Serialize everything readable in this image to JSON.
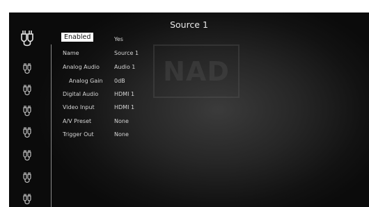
{
  "screen": {
    "title": "Source 1",
    "logo_text": "NAD"
  },
  "sidebar": {
    "icons": [
      {
        "name": "rca-connector-icon",
        "selected": true
      },
      {
        "name": "rca-connector-icon",
        "selected": false
      },
      {
        "name": "rca-connector-icon",
        "selected": false
      },
      {
        "name": "rca-connector-icon",
        "selected": false
      },
      {
        "name": "rca-connector-icon",
        "selected": false
      },
      {
        "name": "rca-connector-icon",
        "selected": false
      },
      {
        "name": "rca-connector-icon",
        "selected": false
      },
      {
        "name": "rca-connector-icon",
        "selected": false
      }
    ]
  },
  "settings": [
    {
      "label": "Enabled",
      "value": "Yes"
    },
    {
      "label": "Name",
      "value": "Source 1"
    },
    {
      "label": "Analog Audio",
      "value": "Audio 1"
    },
    {
      "label": "Analog Gain",
      "value": "0dB"
    },
    {
      "label": "Digital Audio",
      "value": "HDMI 1"
    },
    {
      "label": "Video Input",
      "value": "HDMI 1"
    },
    {
      "label": "A/V Preset",
      "value": "None"
    },
    {
      "label": "Trigger Out",
      "value": "None"
    }
  ],
  "colors": {
    "background": "#1c1c1c",
    "text": "#d6d6d6",
    "highlight": "#ffffff"
  }
}
